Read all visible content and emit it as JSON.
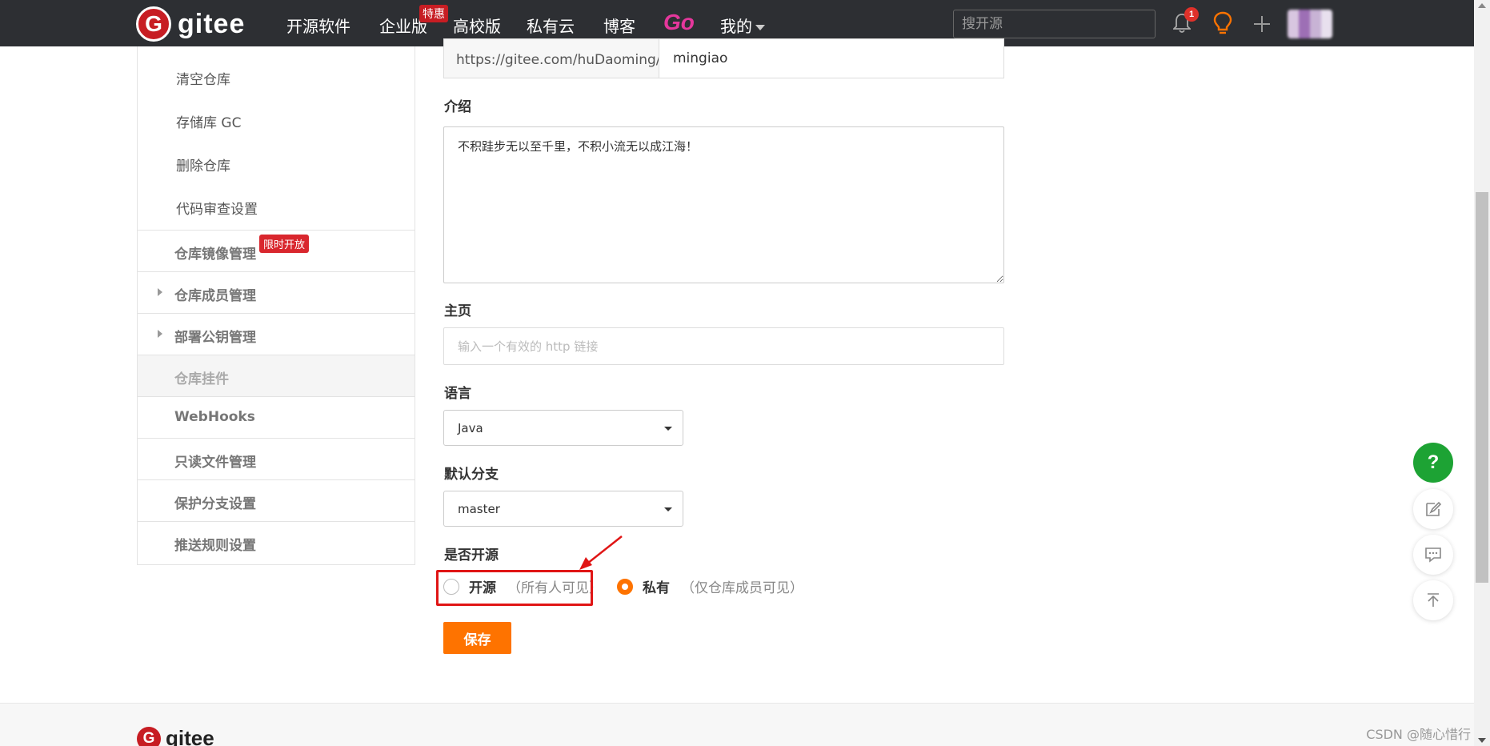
{
  "nav": {
    "logo_badge": "G",
    "logo_text": "gitee",
    "items": [
      "开源软件",
      "企业版",
      "高校版",
      "私有云",
      "博客",
      "Go",
      "我的"
    ],
    "enterprise_badge": "特惠",
    "search_placeholder": "搜开源",
    "notification_count": "1"
  },
  "sidebar": {
    "sub_items": [
      "清空仓库",
      "存储库 GC",
      "删除仓库",
      "代码审查设置"
    ],
    "rows": [
      {
        "label": "仓库镜像管理",
        "badge": "限时开放"
      },
      {
        "label": "仓库成员管理"
      },
      {
        "label": "部署公钥管理"
      },
      {
        "label": "仓库挂件"
      },
      {
        "label": "WebHooks"
      },
      {
        "label": "只读文件管理"
      },
      {
        "label": "保护分支设置"
      },
      {
        "label": "推送规则设置"
      }
    ]
  },
  "form": {
    "path_prefix": "https://gitee.com/huDaoming/",
    "path_value": "mingiao",
    "description_label": "介绍",
    "description_value": "不积跬步无以至千里，不积小流无以成江海！",
    "homepage_label": "主页",
    "homepage_placeholder": "输入一个有效的 http 链接",
    "language_label": "语言",
    "language_value": "Java",
    "branch_label": "默认分支",
    "branch_value": "master",
    "visibility_label": "是否开源",
    "open_label": "开源",
    "open_hint": "（所有人可见）",
    "private_label": "私有",
    "private_hint": "（仅仓库成员可见）",
    "selected_visibility": "private",
    "save_label": "保存"
  },
  "float_buttons": {
    "help": "?"
  },
  "footer": {
    "logo_badge": "G",
    "logo_text": "gitee",
    "watermark": "CSDN @随心惜行"
  },
  "colors": {
    "nav_bg": "#2d2f33",
    "brand_red": "#c71d23",
    "accent_orange": "#fe7300",
    "help_green": "#1da334",
    "annotation_red": "#e01515"
  }
}
